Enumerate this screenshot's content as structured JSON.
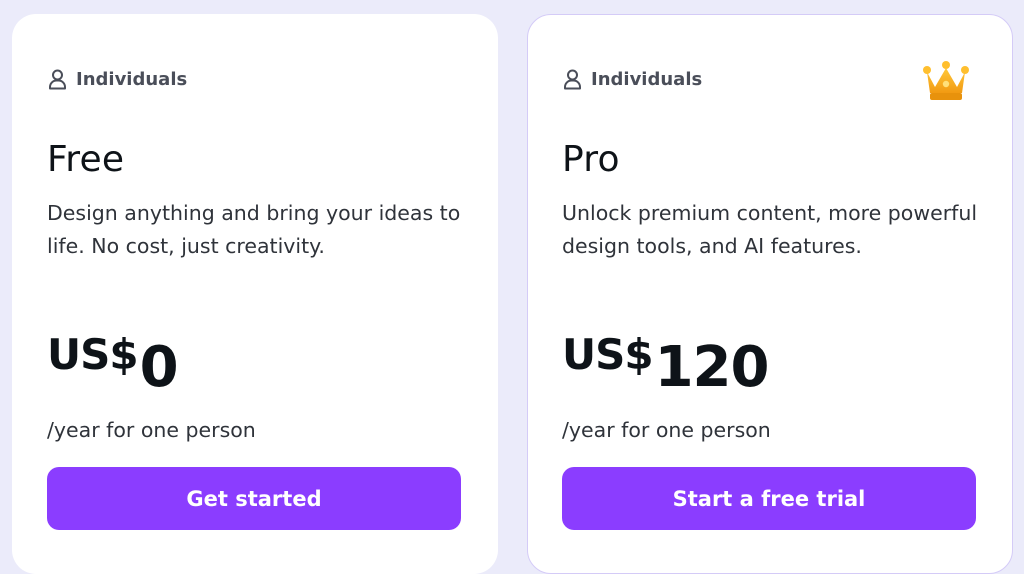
{
  "plans": [
    {
      "audience": "Individuals",
      "audience_icon": "person-icon",
      "name": "Free",
      "description": "Design anything and bring your ideas to life. No cost, just creativity.",
      "currency": "US$",
      "amount": "0",
      "period": "/year for one person",
      "cta_label": "Get started"
    },
    {
      "audience": "Individuals",
      "audience_icon": "person-icon",
      "badge_icon": "crown-icon",
      "name": "Pro",
      "description": "Unlock premium content, more powerful design tools, and AI features.",
      "currency": "US$",
      "amount": "120",
      "period": "/year for one person",
      "cta_label": "Start a free trial"
    }
  ],
  "colors": {
    "background": "#ebebfa",
    "card": "#ffffff",
    "accent": "#8b3dff",
    "crown": "#f5a623",
    "text_dark": "#0e1318",
    "text_body": "#2f333a"
  }
}
